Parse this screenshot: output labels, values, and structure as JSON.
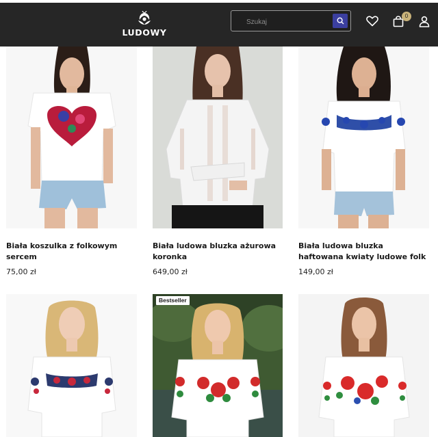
{
  "brand": {
    "name": "LUDOWY",
    "accent": "#3b3fa0",
    "header_bg": "#262626",
    "badge_color": "#c9b37a"
  },
  "search": {
    "placeholder": "Szukaj",
    "value": ""
  },
  "header_icons": {
    "wishlist": "heart-icon",
    "cart": "bag-icon",
    "account": "user-icon",
    "search": "search-icon"
  },
  "cart": {
    "count": "0"
  },
  "products": [
    {
      "title": "Biała koszulka z folkowym sercem",
      "price": "75,00 zł"
    },
    {
      "title": "Biała ludowa bluzka ażurowa koronka",
      "price": "649,00 zł"
    },
    {
      "title": "Biała ludowa bluzka haftowana kwiaty ludowe folk",
      "price": "149,00 zł"
    },
    {
      "title": "",
      "price": ""
    },
    {
      "title": "",
      "price": "",
      "badge": "Bestseller"
    },
    {
      "title": "",
      "price": ""
    }
  ]
}
